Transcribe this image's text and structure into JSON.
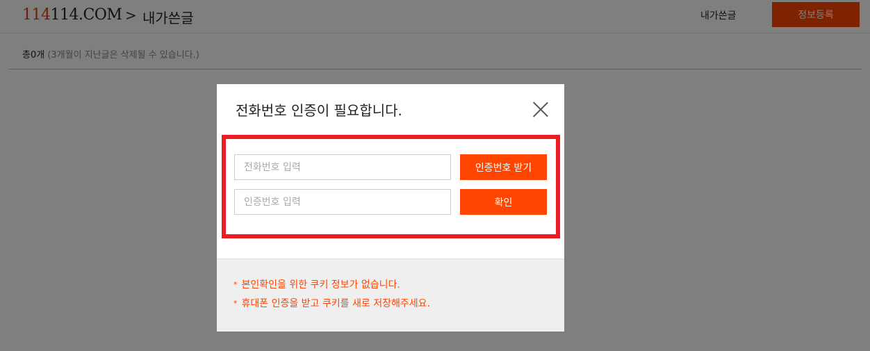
{
  "header": {
    "logo_red": "114",
    "logo_rest": "114.COM",
    "breadcrumb_separator": ">",
    "page_title": "내가쓴글",
    "my_posts_link": "내가쓴글",
    "register_button": "정보등록"
  },
  "summary": {
    "count": "총0개",
    "note": "(3개월이 지난글은 삭제될 수 있습니다.)"
  },
  "modal": {
    "title": "전화번호 인증이 필요합니다.",
    "phone_placeholder": "전화번호 입력",
    "code_placeholder": "인증번호 입력",
    "send_code_button": "인증번호 받기",
    "confirm_button": "확인",
    "notices": [
      {
        "bullet": "*",
        "text": "본인확인을 위한 쿠키 정보가 없습니다."
      },
      {
        "bullet": "*",
        "text": "휴대폰 인증을 받고 쿠키를 새로 저장해주세요."
      }
    ]
  },
  "colors": {
    "accent": "#ff4500",
    "highlight_border": "#ed1c24"
  }
}
